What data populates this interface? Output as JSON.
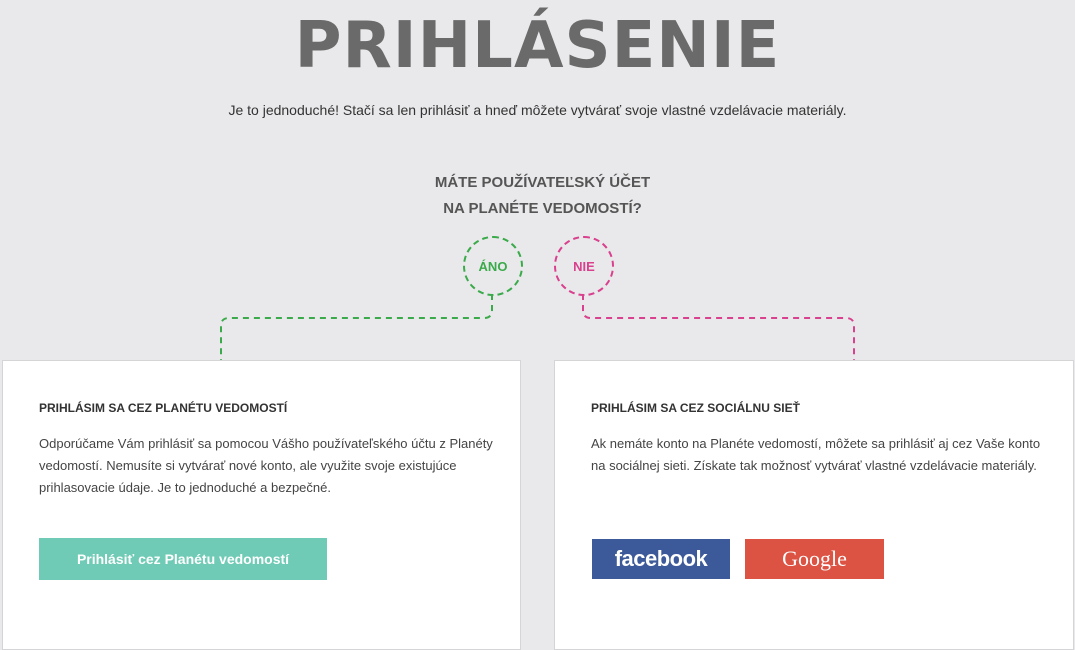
{
  "header": {
    "title": "PRIHLÁSENIE",
    "subtitle": "Je to jednoduché! Stačí sa len prihlásiť a hneď môžete vytvárať svoje vlastné vzdelávacie materiály."
  },
  "question": {
    "line1": "MÁTE POUŽÍVATEĽSKÝ ÚČET",
    "line2": "NA PLANÉTE VEDOMOSTÍ?",
    "yes_label": "ÁNO",
    "no_label": "NIE"
  },
  "colors": {
    "yes": "#3aaa4a",
    "no": "#d9408d",
    "planeta_button": "#6fcbb5",
    "facebook": "#3c5a99",
    "google": "#dc5243"
  },
  "left_card": {
    "title": "PRIHLÁSIM SA CEZ PLANÉTU VEDOMOSTÍ",
    "text": "Odporúčame Vám prihlásiť sa pomocou Vášho používateľského účtu z Planéty vedomostí. Nemusíte si vytvárať nové konto, ale využite svoje existujúce prihlasovacie údaje. Je to jednoduché a bezpečné.",
    "button_label": "Prihlásiť cez Planétu vedomostí"
  },
  "right_card": {
    "title": "PRIHLÁSIM SA CEZ SOCIÁLNU SIEŤ",
    "text": "Ak nemáte konto na Planéte vedomostí, môžete sa prihlásiť aj cez Vaše konto na sociálnej sieti. Získate tak možnosť vytvárať vlastné vzdelávacie materiály.",
    "facebook_label": "facebook",
    "google_label": "Google"
  }
}
